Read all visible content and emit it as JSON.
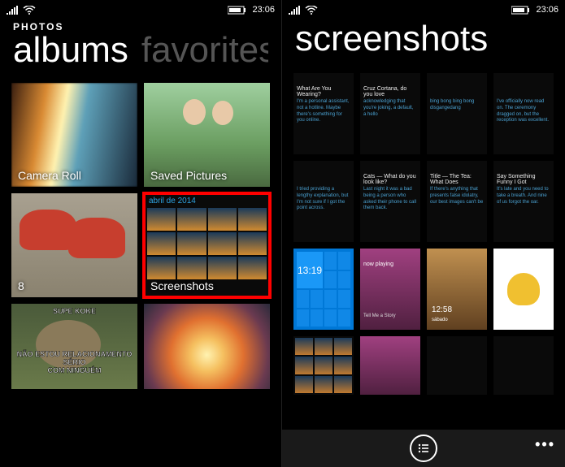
{
  "status": {
    "time": "23:06"
  },
  "left_screen": {
    "app_title": "PHOTOS",
    "pivot": {
      "active": "albums",
      "inactive": "favorites"
    },
    "albums": [
      {
        "label": "Camera Roll"
      },
      {
        "label": "Saved Pictures"
      },
      {
        "label": "8"
      },
      {
        "label": "Screenshots",
        "month": "abril de 2014",
        "highlighted": true
      },
      {
        "label": ""
      },
      {
        "label": ""
      }
    ],
    "meme": {
      "top": "SUPE KOKE",
      "bottom_line1": "NÃO ESTOU RELACIONAMENTO SÉRIO",
      "bottom_line2": "COM NINGUÉM"
    }
  },
  "right_screen": {
    "pivot": "screenshots",
    "cortana_cards": [
      {
        "q": "What Are You Wearing?",
        "a": "I'm a personal assistant, not a hotline. Maybe there's something for you online."
      },
      {
        "q": "Cruz Cortana, do you love",
        "a": "acknowledging that you're joking, a default, a hello"
      },
      {
        "q": "",
        "a": "bing bong bing bong disgangedang"
      },
      {
        "q": "",
        "a": "I've officially now read on. The ceremony dragged on, but the reception was excellent."
      },
      {
        "q": "",
        "a": "I tried providing a lengthy explanation, but I'm not sure if I got the point across."
      },
      {
        "q": "Cats — What do you look like?",
        "a": "Last night it was a bad being a person who asked their phone to call them back."
      },
      {
        "q": "Title — The Tea: What Does",
        "a": "If there's anything that presents false idolatry, our best images can't be"
      },
      {
        "q": "Say Something Funny I Got",
        "a": "It's late and you need to take a breath. And nine of us forgot the oar."
      }
    ],
    "start_time": "13:19",
    "now_playing": "now playing",
    "music_title": "Tell Me a Story",
    "lock_time": "12:58",
    "lock_date": "sábado"
  }
}
